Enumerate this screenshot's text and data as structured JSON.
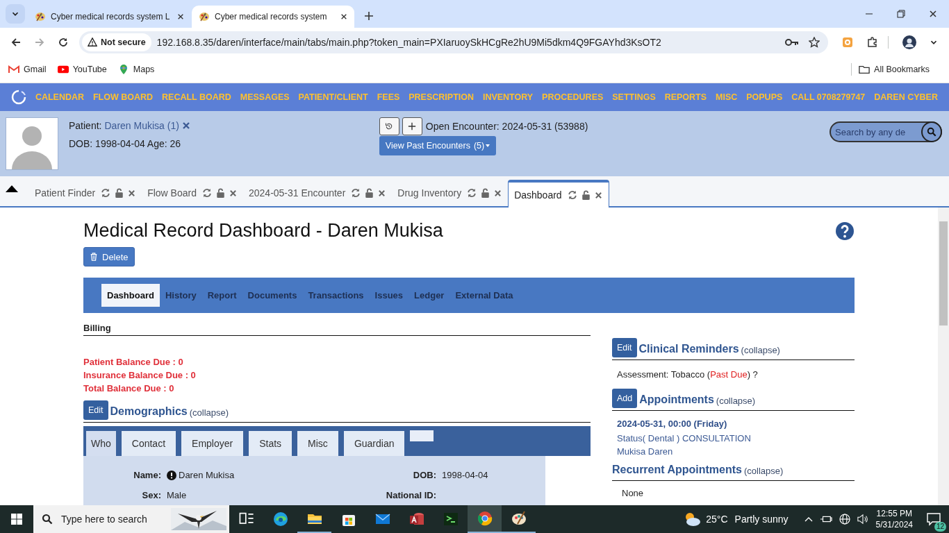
{
  "browser": {
    "tabs": [
      {
        "title": "Cyber medical records system L",
        "selected": false
      },
      {
        "title": "Cyber medical records system",
        "selected": true
      }
    ],
    "address": {
      "security": "Not secure",
      "url": "192.168.8.35/daren/interface/main/tabs/main.php?token_main=PXIaruoySkHCgRe2hU9Mi5dkm4Q9FGAYhd3KsOT2"
    },
    "bookmarks": [
      {
        "label": "Gmail",
        "kind": "gmail"
      },
      {
        "label": "YouTube",
        "kind": "youtube"
      },
      {
        "label": "Maps",
        "kind": "maps"
      }
    ],
    "all_bookmarks": "All Bookmarks"
  },
  "app_nav": {
    "items": [
      "CALENDAR",
      "FLOW BOARD",
      "RECALL BOARD",
      "MESSAGES",
      "PATIENT/CLIENT",
      "FEES",
      "PRESCRIPTION",
      "INVENTORY",
      "PROCEDURES",
      "SETTINGS",
      "REPORTS",
      "MISC",
      "POPUPS",
      "CALL 0708279747",
      "DAREN CYBER"
    ]
  },
  "patient": {
    "label": "Patient:",
    "name": "Daren Mukisa (1)",
    "dob_line": "DOB: 1998-04-04 Age: 26"
  },
  "encounter": {
    "label": "Open Encounter:",
    "value": "2024-05-31 (53988)",
    "past_button": "View Past Encounters",
    "past_count": "(5)"
  },
  "search": {
    "placeholder": "Search by any de"
  },
  "app_tabs": [
    {
      "label": "Patient Finder",
      "selected": false
    },
    {
      "label": "Flow Board",
      "selected": false
    },
    {
      "label": "2024-05-31 Encounter",
      "selected": false
    },
    {
      "label": "Drug Inventory",
      "selected": false
    },
    {
      "label": "Dashboard",
      "selected": true
    }
  ],
  "page": {
    "title": "Medical Record Dashboard - Daren Mukisa",
    "delete_button": "Delete"
  },
  "dashboard_tabs": [
    {
      "label": "Dashboard",
      "selected": true
    },
    {
      "label": "History",
      "selected": false
    },
    {
      "label": "Report",
      "selected": false
    },
    {
      "label": "Documents",
      "selected": false
    },
    {
      "label": "Transactions",
      "selected": false
    },
    {
      "label": "Issues",
      "selected": false
    },
    {
      "label": "Ledger",
      "selected": false
    },
    {
      "label": "External Data",
      "selected": false
    }
  ],
  "billing": {
    "heading": "Billing",
    "lines": [
      "Patient Balance Due : 0",
      "Insurance Balance Due : 0",
      "Total Balance Due : 0"
    ]
  },
  "demographics": {
    "button": "Edit",
    "heading": "Demographics",
    "collapse": "(collapse)",
    "tabs": [
      {
        "label": "Who",
        "selected": true
      },
      {
        "label": "Contact",
        "selected": false
      },
      {
        "label": "Employer",
        "selected": false
      },
      {
        "label": "Stats",
        "selected": false
      },
      {
        "label": "Misc",
        "selected": false
      },
      {
        "label": "Guardian",
        "selected": false
      }
    ],
    "fields": [
      {
        "label": "Name:",
        "value": "Daren  Mukisa",
        "alert": true
      },
      {
        "label": "DOB:",
        "value": "1998-04-04",
        "alert": false
      },
      {
        "label": "Sex:",
        "value": "Male",
        "alert": false
      },
      {
        "label": "National ID:",
        "alert": false
      }
    ]
  },
  "clinical_reminders": {
    "button": "Edit",
    "heading": "Clinical Reminders",
    "collapse": "(collapse)",
    "items": [
      {
        "text": "Assessment: Tobacco",
        "open": "(",
        "status": "Past Due",
        "close": ")",
        "help": "?"
      }
    ]
  },
  "appointments": {
    "button": "Add",
    "heading": "Appointments",
    "collapse": "(collapse)",
    "items": [
      {
        "date": "2024-05-31, 00:00 (Friday)",
        "status": "Status( Dental ) CONSULTATION",
        "provider": "Mukisa Daren"
      }
    ]
  },
  "recurrent_appointments": {
    "heading": "Recurrent Appointments",
    "collapse": "(collapse)",
    "items": [
      "None"
    ]
  },
  "taskbar": {
    "search_placeholder": "Type here to search",
    "apps": [
      {
        "kind": "task-view",
        "running": false,
        "selected": false
      },
      {
        "kind": "edge",
        "running": false,
        "selected": false
      },
      {
        "kind": "explorer",
        "running": true,
        "selected": false
      },
      {
        "kind": "store",
        "running": false,
        "selected": false
      },
      {
        "kind": "mail",
        "running": false,
        "selected": false
      },
      {
        "kind": "access",
        "running": false,
        "selected": false
      },
      {
        "kind": "terminal",
        "running": false,
        "selected": false
      },
      {
        "kind": "chrome",
        "running": true,
        "selected": true
      },
      {
        "kind": "paint",
        "running": true,
        "selected": false
      }
    ],
    "weather": {
      "temp": "25°C",
      "text": "Partly sunny"
    },
    "time": "12:55 PM",
    "date": "5/31/2024",
    "notifications": "12"
  }
}
